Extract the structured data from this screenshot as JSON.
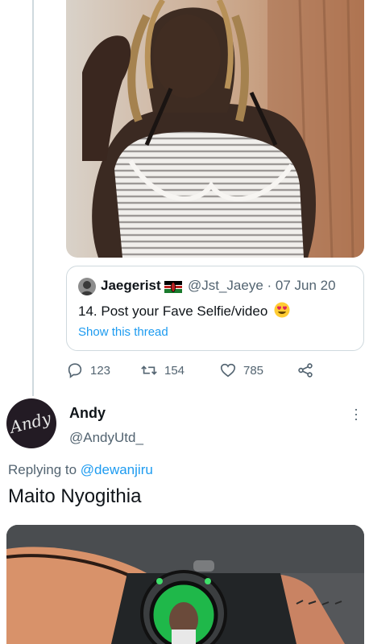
{
  "quoted_tweet": {
    "name": "Jaegerist",
    "handle_date": "@Jst_Jaeye · 07 Jun 20",
    "text": "14. Post your Fave Selfie/video",
    "show_thread": "Show this thread"
  },
  "actions": {
    "replies": "123",
    "retweets": "154",
    "likes": "785"
  },
  "reply_tweet": {
    "avatar_text": "Andy",
    "name": "Andy",
    "handle": "@AndyUtd_",
    "replying_to_prefix": "Replying to ",
    "replying_to_mention": "@dewanjiru",
    "text": "Maito Nyogithia"
  },
  "colors": {
    "accent": "#1d9bf0",
    "muted": "#536471",
    "border": "#cfd9de"
  }
}
